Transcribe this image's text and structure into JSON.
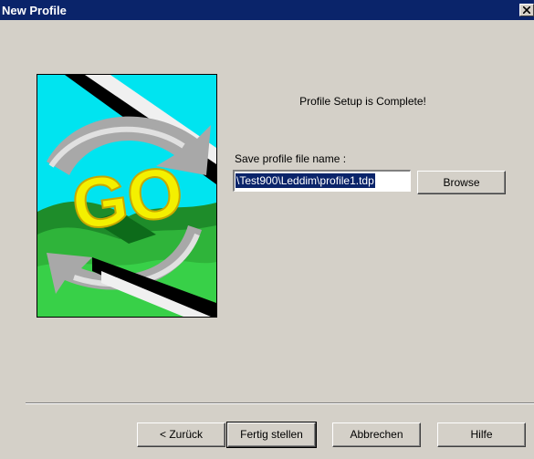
{
  "window": {
    "title": "New Profile"
  },
  "main": {
    "complete_text": "Profile Setup is Complete!",
    "save_label": "Save profile file name :",
    "filename_value": "\\Test900\\Leddim\\profile1.tdp",
    "browse_label": "Browse",
    "image_text": "GO"
  },
  "footer": {
    "back_label": "< Zurück",
    "finish_label": "Fertig stellen",
    "cancel_label": "Abbrechen",
    "help_label": "Hilfe"
  },
  "colors": {
    "titlebar": "#0a246a",
    "dialog_bg": "#d4d0c8",
    "selection": "#0a246a"
  },
  "icons": {
    "close": "close-icon"
  }
}
